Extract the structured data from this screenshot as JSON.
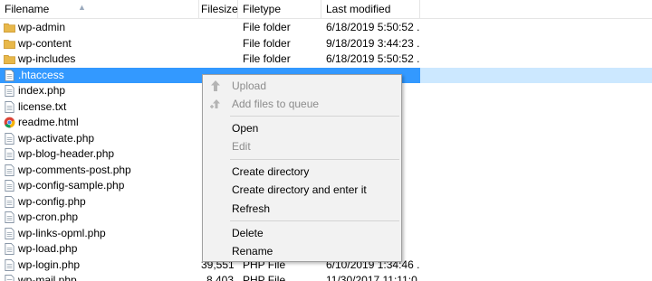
{
  "columns": {
    "filename": "Filename",
    "filesize": "Filesize",
    "filetype": "Filetype",
    "modified": "Last modified"
  },
  "files": [
    {
      "name": "wp-admin",
      "size": "",
      "type": "File folder",
      "modified": "6/18/2019 5:50:52 ...",
      "icon": "folder-icon",
      "selected": false
    },
    {
      "name": "wp-content",
      "size": "",
      "type": "File folder",
      "modified": "9/18/2019 3:44:23 ...",
      "icon": "folder-icon",
      "selected": false
    },
    {
      "name": "wp-includes",
      "size": "",
      "type": "File folder",
      "modified": "6/18/2019 5:50:52 ...",
      "icon": "folder-icon",
      "selected": false
    },
    {
      "name": ".htaccess",
      "size": "",
      "type": "",
      "modified": "",
      "icon": "file-icon",
      "selected": true
    },
    {
      "name": "index.php",
      "size": "",
      "type": "",
      "modified": "",
      "icon": "file-icon",
      "selected": false
    },
    {
      "name": "license.txt",
      "size": "",
      "type": "",
      "modified": "",
      "icon": "file-icon",
      "selected": false
    },
    {
      "name": "readme.html",
      "size": "",
      "type": "",
      "modified": "AM",
      "icon": "chrome-icon",
      "selected": false
    },
    {
      "name": "wp-activate.php",
      "size": "",
      "type": "",
      "modified": "",
      "icon": "file-icon",
      "selected": false
    },
    {
      "name": "wp-blog-header.php",
      "size": "",
      "type": "",
      "modified": "",
      "icon": "file-icon",
      "selected": false
    },
    {
      "name": "wp-comments-post.php",
      "size": "",
      "type": "",
      "modified": "AM",
      "icon": "file-icon",
      "selected": false
    },
    {
      "name": "wp-config-sample.php",
      "size": "",
      "type": "",
      "modified": "AM",
      "icon": "file-icon",
      "selected": false
    },
    {
      "name": "wp-config.php",
      "size": "",
      "type": "",
      "modified": "",
      "icon": "file-icon",
      "selected": false
    },
    {
      "name": "wp-cron.php",
      "size": "",
      "type": "",
      "modified": "AM",
      "icon": "file-icon",
      "selected": false
    },
    {
      "name": "wp-links-opml.php",
      "size": "",
      "type": "",
      "modified": "",
      "icon": "file-icon",
      "selected": false
    },
    {
      "name": "wp-load.php",
      "size": "",
      "type": "",
      "modified": "",
      "icon": "file-icon",
      "selected": false
    },
    {
      "name": "wp-login.php",
      "size": "39,551",
      "type": "PHP File",
      "modified": "6/10/2019 1:34:46 ...",
      "icon": "file-icon",
      "selected": false
    },
    {
      "name": "wp-mail.php",
      "size": "8,403",
      "type": "PHP File",
      "modified": "11/30/2017 11:11:0...",
      "icon": "file-icon",
      "selected": false
    }
  ],
  "context_menu": {
    "upload": "Upload",
    "add_to_queue": "Add files to queue",
    "open": "Open",
    "edit": "Edit",
    "create_dir": "Create directory",
    "create_dir_enter": "Create directory and enter it",
    "refresh": "Refresh",
    "delete": "Delete",
    "rename": "Rename"
  },
  "colors": {
    "selection": "#3399ff",
    "menu_bg": "#f2f2f2",
    "disabled_text": "#8c8c8c",
    "folder": "#e8b84a"
  }
}
